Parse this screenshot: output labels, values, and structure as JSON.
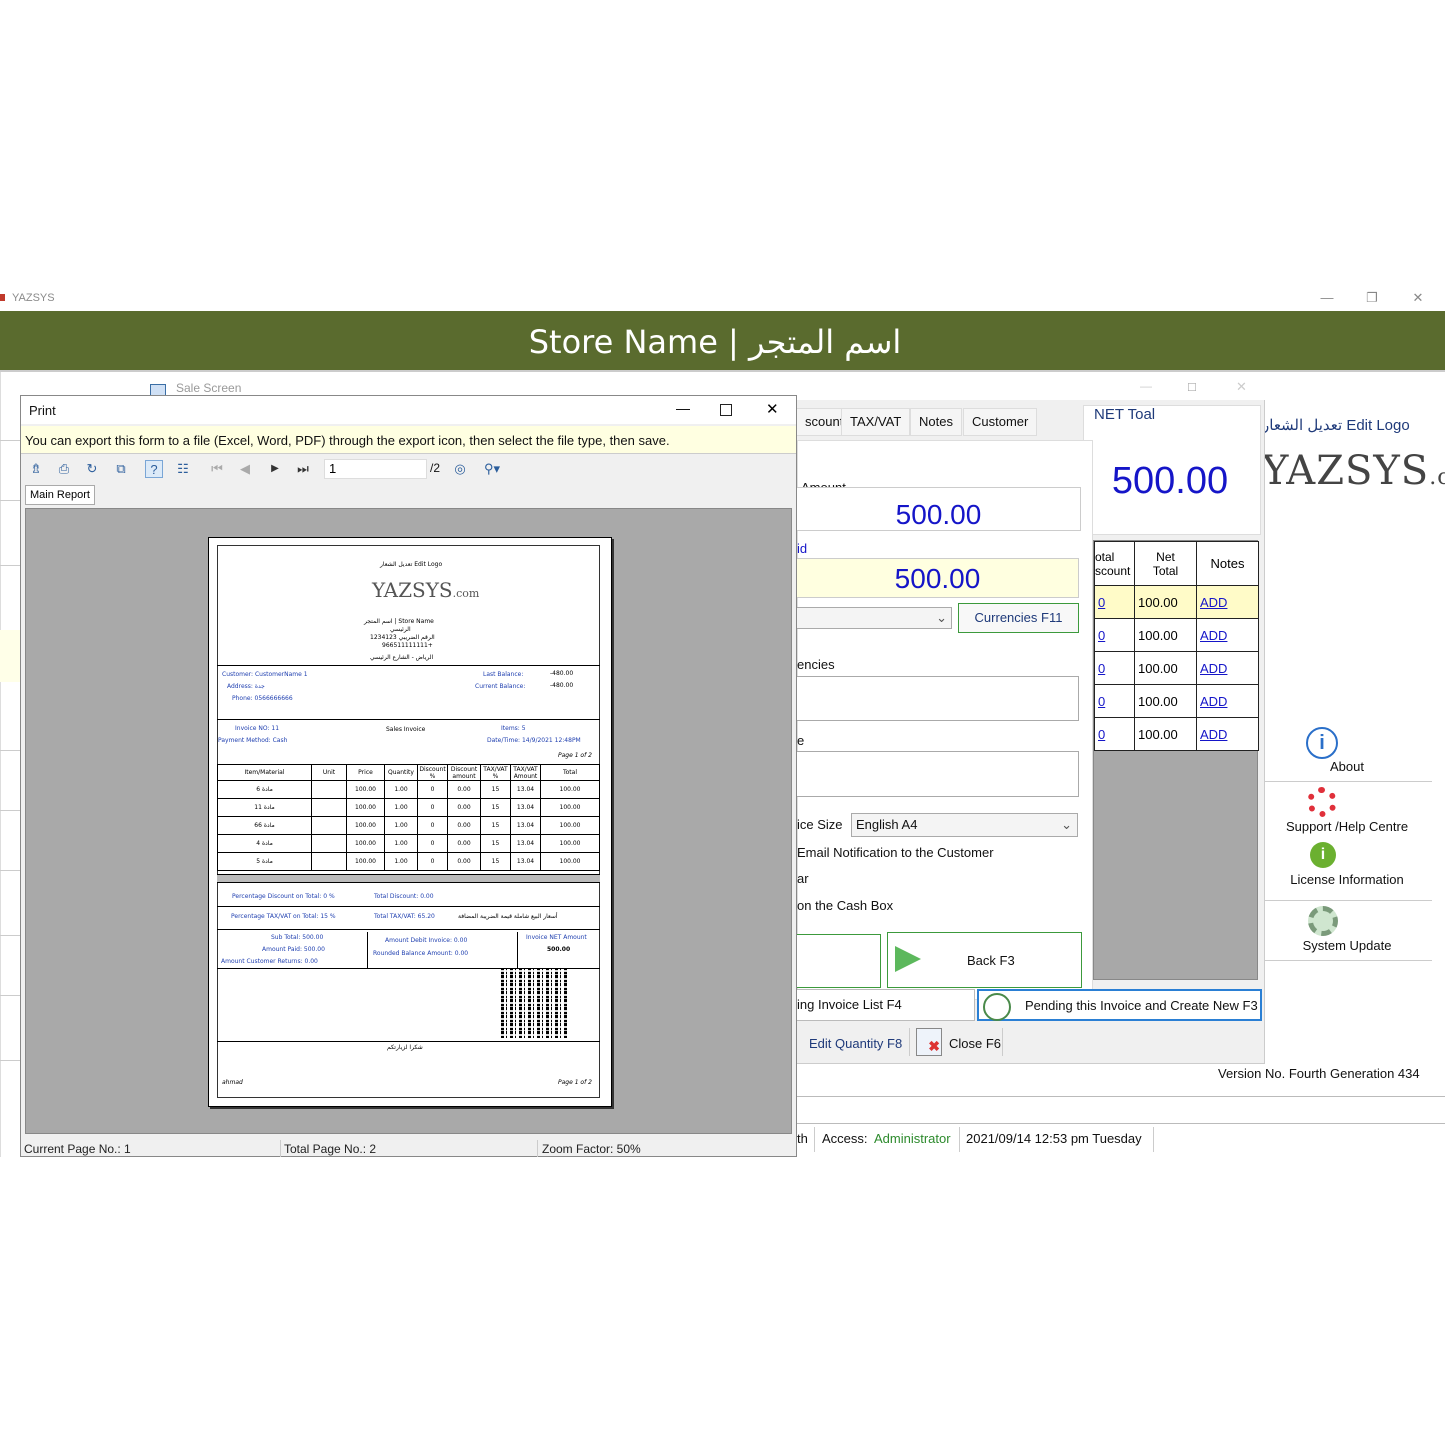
{
  "app": {
    "title": "YAZSYS",
    "store_name": "Store Name | اسم المتجر",
    "edit_logo": "تعديل الشعار Edit Logo",
    "brand": "YAZSYS",
    "brand_suffix": ".com",
    "version": "Version No.  Fourth Generation 434"
  },
  "sidebar": {
    "about": "About",
    "support": "Support /Help Centre",
    "license": "License Information",
    "update": "System Update"
  },
  "status": {
    "partial": "th",
    "access_label": "Access:",
    "access_value": "Administrator",
    "datetime": "2021/09/14 12:53 pm Tuesday"
  },
  "sale": {
    "window_title": "Sale Screen",
    "tabs": [
      "scount",
      "TAX/VAT",
      "Notes",
      "Customer"
    ],
    "net_label": "NET Toal",
    "net_value": "500.00",
    "amount_label": "Amount",
    "amount_value": "500.00",
    "paid_label": "id",
    "paid_value": "500.00",
    "currencies_button": "Currencies F11",
    "currencies_label": "encies",
    "notes_label": "e",
    "invoice_size_label": "ice Size",
    "invoice_size_value": "English A4",
    "email_label": "Email Notification to the Customer",
    "opt_ar": "ar",
    "cash_box_label": "on the Cash Box",
    "back_button": "Back F3",
    "invoice_list_button": "ing  Invoice List F4",
    "pending_button": "Pending this Invoice and Create New F3",
    "edit_qty_button": "Edit Quantity F8",
    "close_button": "Close F6",
    "grid_headers": [
      "otal\nscount",
      "Net\nTotal",
      "Notes"
    ],
    "grid_rows": [
      {
        "disc": "0",
        "net": "100.00",
        "notes": "ADD"
      },
      {
        "disc": "0",
        "net": "100.00",
        "notes": "ADD"
      },
      {
        "disc": "0",
        "net": "100.00",
        "notes": "ADD"
      },
      {
        "disc": "0",
        "net": "100.00",
        "notes": "ADD"
      },
      {
        "disc": "0",
        "net": "100.00",
        "notes": "ADD"
      }
    ]
  },
  "print": {
    "title": "Print",
    "info": "You can export this form to a file (Excel, Word, PDF) through the export icon, then select the file type, then save.",
    "page_value": "1",
    "page_total": "/2",
    "tab_main": "Main Report",
    "current_page": "Current Page No.: 1",
    "total_pages": "Total Page No.: 2",
    "zoom": "Zoom Factor: 50%"
  },
  "invoice": {
    "edit_logo": "تعديل الشعار Edit Logo",
    "brand": "YAZSYS",
    "brand_suffix": ".com",
    "store": "اسم المتجر | Store Name",
    "store_line2": "الرئيسي",
    "tax_no": "الرقم الضريبي 1234123",
    "phone": "966511111111+",
    "address": "الرياض - الشارع الرئيسي",
    "customer": "Customer:  CustomerName 1",
    "address_label": "Address:  جدة",
    "phone_label": "Phone:  0566666666",
    "last_balance": "Last Balance:",
    "last_balance_val": "-480.00",
    "current_balance": "Current Balance:",
    "current_balance_val": "-480.00",
    "invoice_no": "Invoice NO:  11",
    "payment": "Payment Method:  Cash",
    "type": "Sales Invoice",
    "items": "Items:  5",
    "date": "Date/Time:  14/9/2021 12:48PM",
    "page_top": "Page 1 of 2",
    "headers": [
      "Item/Material",
      "Unit",
      "Price",
      "Quantity",
      "Discount %",
      "Discount amount",
      "TAX/VAT %",
      "TAX/VAT Amount",
      "Total"
    ],
    "rows": [
      [
        "6 مادة",
        "",
        "100.00",
        "1.00",
        "0",
        "0.00",
        "15",
        "13.04",
        "100.00"
      ],
      [
        "11 مادة",
        "",
        "100.00",
        "1.00",
        "0",
        "0.00",
        "15",
        "13.04",
        "100.00"
      ],
      [
        "66 مادة",
        "",
        "100.00",
        "1.00",
        "0",
        "0.00",
        "15",
        "13.04",
        "100.00"
      ],
      [
        "4 مادة",
        "",
        "100.00",
        "1.00",
        "0",
        "0.00",
        "15",
        "13.04",
        "100.00"
      ],
      [
        "5 مادة",
        "",
        "100.00",
        "1.00",
        "0",
        "0.00",
        "15",
        "13.04",
        "100.00"
      ]
    ],
    "pct_discount": "Percentage Discount on Total:   0    %",
    "total_discount": "Total Discount:        0.00",
    "pct_vat": "Percentage TAX/VAT on Total:   15    %",
    "total_vat": "Total TAX/VAT:        65.20",
    "vat_note": "أسعار البيع شاملة قيمة الضريبة المضافة",
    "subtotal": "Sub Total:       500.00",
    "amount_paid": "Amount Paid:       500.00",
    "returns": "Amount Customer Returns:        0.00",
    "debit": "Amount Debit Invoice:        0.00",
    "rounded": "Rounded Balance Amount:        0.00",
    "net_label": "Invoice NET Amount",
    "net_value": "500.00",
    "thanks": "شكرا لزيارتكم",
    "user": "ahmad",
    "page_bottom": "Page 1 of 2"
  }
}
